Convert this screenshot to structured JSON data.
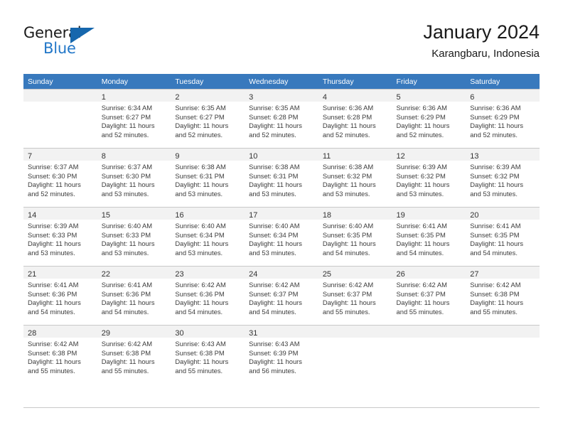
{
  "brand": {
    "logo_text_top": "General",
    "logo_text_bottom": "Blue",
    "logo_icon": "triangle-icon",
    "color_dark": "#1a1a1a",
    "color_blue": "#2277c8",
    "color_triangle": "#1667ad"
  },
  "header": {
    "title": "January 2024",
    "subtitle": "Karangbaru, Indonesia"
  },
  "theme": {
    "header_bg": "#3879bd",
    "header_text": "#ffffff",
    "daynum_bg": "#f2f2f2",
    "grid_line": "#c8c8c8",
    "body_text": "#3b3b3b"
  },
  "weekdays": [
    "Sunday",
    "Monday",
    "Tuesday",
    "Wednesday",
    "Thursday",
    "Friday",
    "Saturday"
  ],
  "weeks": [
    [
      {
        "day": "",
        "lines": []
      },
      {
        "day": "1",
        "lines": [
          "Sunrise: 6:34 AM",
          "Sunset: 6:27 PM",
          "Daylight: 11 hours",
          "and 52 minutes."
        ]
      },
      {
        "day": "2",
        "lines": [
          "Sunrise: 6:35 AM",
          "Sunset: 6:27 PM",
          "Daylight: 11 hours",
          "and 52 minutes."
        ]
      },
      {
        "day": "3",
        "lines": [
          "Sunrise: 6:35 AM",
          "Sunset: 6:28 PM",
          "Daylight: 11 hours",
          "and 52 minutes."
        ]
      },
      {
        "day": "4",
        "lines": [
          "Sunrise: 6:36 AM",
          "Sunset: 6:28 PM",
          "Daylight: 11 hours",
          "and 52 minutes."
        ]
      },
      {
        "day": "5",
        "lines": [
          "Sunrise: 6:36 AM",
          "Sunset: 6:29 PM",
          "Daylight: 11 hours",
          "and 52 minutes."
        ]
      },
      {
        "day": "6",
        "lines": [
          "Sunrise: 6:36 AM",
          "Sunset: 6:29 PM",
          "Daylight: 11 hours",
          "and 52 minutes."
        ]
      }
    ],
    [
      {
        "day": "7",
        "lines": [
          "Sunrise: 6:37 AM",
          "Sunset: 6:30 PM",
          "Daylight: 11 hours",
          "and 52 minutes."
        ]
      },
      {
        "day": "8",
        "lines": [
          "Sunrise: 6:37 AM",
          "Sunset: 6:30 PM",
          "Daylight: 11 hours",
          "and 53 minutes."
        ]
      },
      {
        "day": "9",
        "lines": [
          "Sunrise: 6:38 AM",
          "Sunset: 6:31 PM",
          "Daylight: 11 hours",
          "and 53 minutes."
        ]
      },
      {
        "day": "10",
        "lines": [
          "Sunrise: 6:38 AM",
          "Sunset: 6:31 PM",
          "Daylight: 11 hours",
          "and 53 minutes."
        ]
      },
      {
        "day": "11",
        "lines": [
          "Sunrise: 6:38 AM",
          "Sunset: 6:32 PM",
          "Daylight: 11 hours",
          "and 53 minutes."
        ]
      },
      {
        "day": "12",
        "lines": [
          "Sunrise: 6:39 AM",
          "Sunset: 6:32 PM",
          "Daylight: 11 hours",
          "and 53 minutes."
        ]
      },
      {
        "day": "13",
        "lines": [
          "Sunrise: 6:39 AM",
          "Sunset: 6:32 PM",
          "Daylight: 11 hours",
          "and 53 minutes."
        ]
      }
    ],
    [
      {
        "day": "14",
        "lines": [
          "Sunrise: 6:39 AM",
          "Sunset: 6:33 PM",
          "Daylight: 11 hours",
          "and 53 minutes."
        ]
      },
      {
        "day": "15",
        "lines": [
          "Sunrise: 6:40 AM",
          "Sunset: 6:33 PM",
          "Daylight: 11 hours",
          "and 53 minutes."
        ]
      },
      {
        "day": "16",
        "lines": [
          "Sunrise: 6:40 AM",
          "Sunset: 6:34 PM",
          "Daylight: 11 hours",
          "and 53 minutes."
        ]
      },
      {
        "day": "17",
        "lines": [
          "Sunrise: 6:40 AM",
          "Sunset: 6:34 PM",
          "Daylight: 11 hours",
          "and 53 minutes."
        ]
      },
      {
        "day": "18",
        "lines": [
          "Sunrise: 6:40 AM",
          "Sunset: 6:35 PM",
          "Daylight: 11 hours",
          "and 54 minutes."
        ]
      },
      {
        "day": "19",
        "lines": [
          "Sunrise: 6:41 AM",
          "Sunset: 6:35 PM",
          "Daylight: 11 hours",
          "and 54 minutes."
        ]
      },
      {
        "day": "20",
        "lines": [
          "Sunrise: 6:41 AM",
          "Sunset: 6:35 PM",
          "Daylight: 11 hours",
          "and 54 minutes."
        ]
      }
    ],
    [
      {
        "day": "21",
        "lines": [
          "Sunrise: 6:41 AM",
          "Sunset: 6:36 PM",
          "Daylight: 11 hours",
          "and 54 minutes."
        ]
      },
      {
        "day": "22",
        "lines": [
          "Sunrise: 6:41 AM",
          "Sunset: 6:36 PM",
          "Daylight: 11 hours",
          "and 54 minutes."
        ]
      },
      {
        "day": "23",
        "lines": [
          "Sunrise: 6:42 AM",
          "Sunset: 6:36 PM",
          "Daylight: 11 hours",
          "and 54 minutes."
        ]
      },
      {
        "day": "24",
        "lines": [
          "Sunrise: 6:42 AM",
          "Sunset: 6:37 PM",
          "Daylight: 11 hours",
          "and 54 minutes."
        ]
      },
      {
        "day": "25",
        "lines": [
          "Sunrise: 6:42 AM",
          "Sunset: 6:37 PM",
          "Daylight: 11 hours",
          "and 55 minutes."
        ]
      },
      {
        "day": "26",
        "lines": [
          "Sunrise: 6:42 AM",
          "Sunset: 6:37 PM",
          "Daylight: 11 hours",
          "and 55 minutes."
        ]
      },
      {
        "day": "27",
        "lines": [
          "Sunrise: 6:42 AM",
          "Sunset: 6:38 PM",
          "Daylight: 11 hours",
          "and 55 minutes."
        ]
      }
    ],
    [
      {
        "day": "28",
        "lines": [
          "Sunrise: 6:42 AM",
          "Sunset: 6:38 PM",
          "Daylight: 11 hours",
          "and 55 minutes."
        ]
      },
      {
        "day": "29",
        "lines": [
          "Sunrise: 6:42 AM",
          "Sunset: 6:38 PM",
          "Daylight: 11 hours",
          "and 55 minutes."
        ]
      },
      {
        "day": "30",
        "lines": [
          "Sunrise: 6:43 AM",
          "Sunset: 6:38 PM",
          "Daylight: 11 hours",
          "and 55 minutes."
        ]
      },
      {
        "day": "31",
        "lines": [
          "Sunrise: 6:43 AM",
          "Sunset: 6:39 PM",
          "Daylight: 11 hours",
          "and 56 minutes."
        ]
      },
      {
        "day": "",
        "lines": []
      },
      {
        "day": "",
        "lines": []
      },
      {
        "day": "",
        "lines": []
      }
    ]
  ]
}
